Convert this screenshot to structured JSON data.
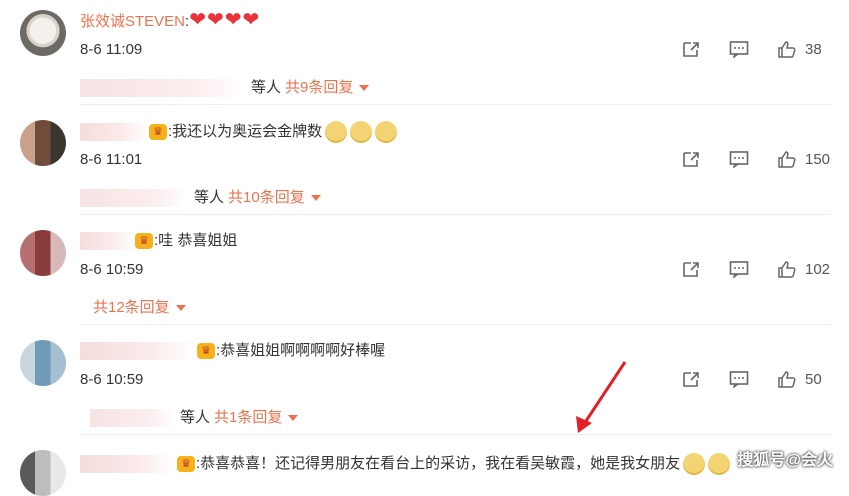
{
  "comments": [
    {
      "username": "张效诚STEVEN",
      "text": ":",
      "hearts": "❤❤❤❤",
      "time": "8-6 11:09",
      "likes": "38",
      "reply_etc": "等人",
      "reply_count": "共9条回复"
    },
    {
      "text": ":我还以为奥运会金牌数",
      "time": "8-6 11:01",
      "likes": "150",
      "reply_etc": "等人",
      "reply_count": "共10条回复"
    },
    {
      "text": ":哇 恭喜姐姐",
      "time": "8-6 10:59",
      "likes": "102",
      "reply_count": "共12条回复"
    },
    {
      "text": ":恭喜姐姐啊啊啊啊好棒喔",
      "time": "8-6 10:59",
      "likes": "50",
      "reply_etc": "等人",
      "reply_count": "共1条回复"
    },
    {
      "text": ":恭喜恭喜！还记得男朋友在看台上的采访，我在看吴敏霞，她是我女朋友"
    }
  ],
  "watermark": "搜狐号@会火",
  "colors": {
    "accent": "#eb7350",
    "arrow": "#e0202a"
  },
  "icons": [
    "share-icon",
    "comment-icon",
    "like-icon",
    "vip-crown-icon",
    "dropdown-caret-icon"
  ]
}
